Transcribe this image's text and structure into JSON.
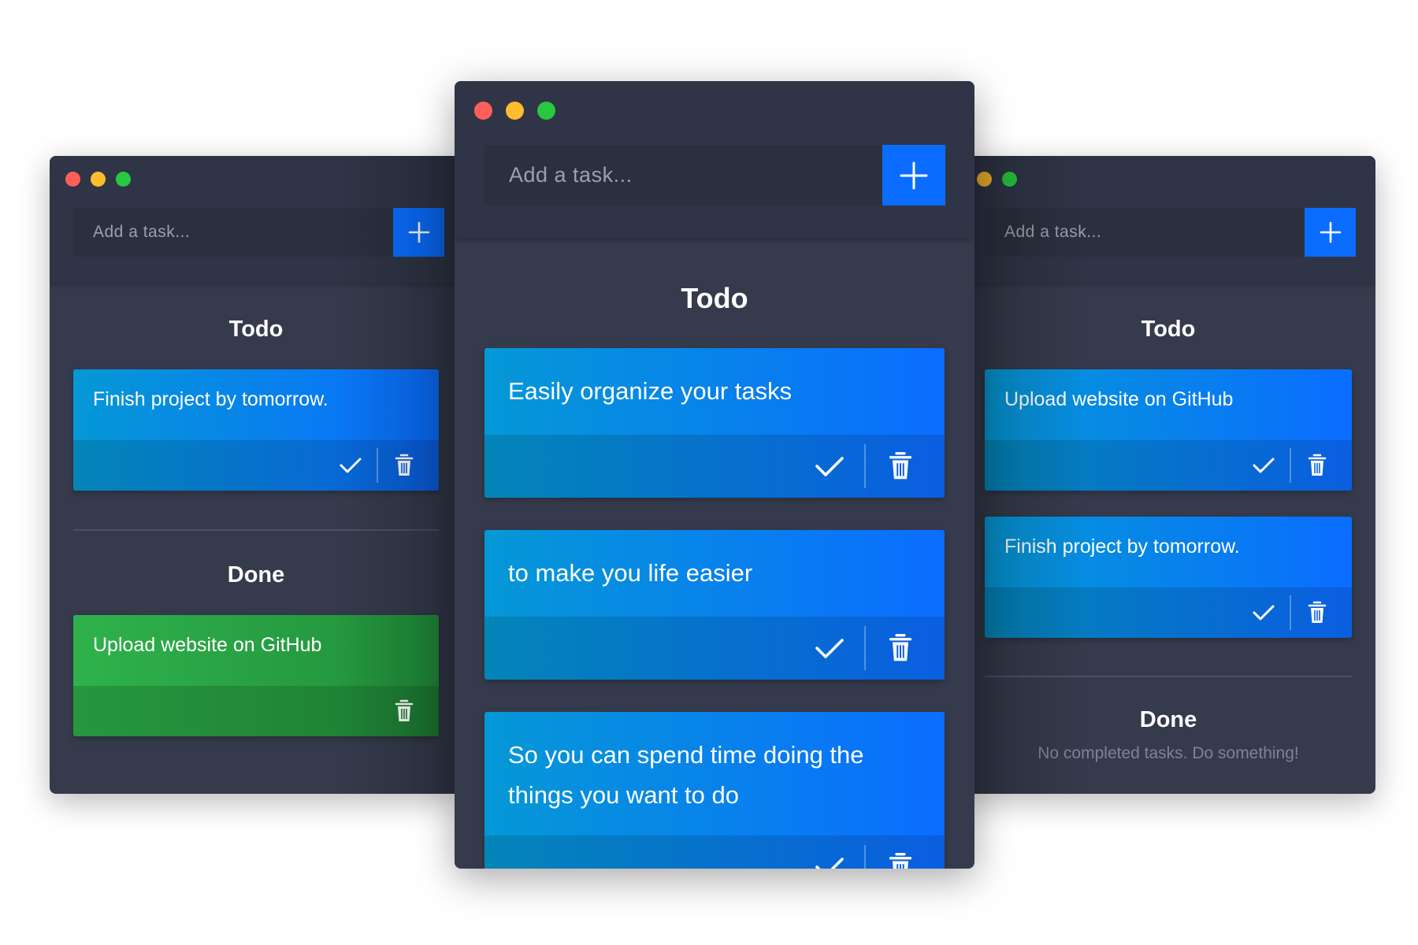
{
  "left_window": {
    "input_placeholder": "Add a task...",
    "todo_title": "Todo",
    "todo_tasks": [
      {
        "text": "Finish project by tomorrow."
      }
    ],
    "done_title": "Done",
    "done_tasks": [
      {
        "text": "Upload website on GitHub"
      }
    ]
  },
  "center_window": {
    "input_placeholder": "Add a task...",
    "todo_title": "Todo",
    "todo_tasks": [
      {
        "text": "Easily organize your tasks"
      },
      {
        "text": "to make you life easier"
      },
      {
        "text": "So you can spend time doing the things you want to do"
      }
    ]
  },
  "right_window": {
    "input_placeholder": "Add a task...",
    "todo_title": "Todo",
    "todo_tasks": [
      {
        "text": "Upload website on GitHub"
      },
      {
        "text": "Finish project by tomorrow."
      }
    ],
    "done_title": "Done",
    "done_empty_text": "No completed tasks. Do something!"
  },
  "icons": {
    "add": "plus-icon",
    "complete": "check-icon",
    "delete": "trash-icon"
  },
  "colors": {
    "window_bg": "#353b4c",
    "header_bg": "#2f3546",
    "input_bg": "#2a303f",
    "accent_blue": "#0a6dff",
    "todo_card_from": "#0598d6",
    "todo_card_to": "#0a6dff",
    "done_card": "#2fb24c",
    "traffic_red": "#ff5f57",
    "traffic_yellow": "#febc2e",
    "traffic_green": "#28c840"
  }
}
